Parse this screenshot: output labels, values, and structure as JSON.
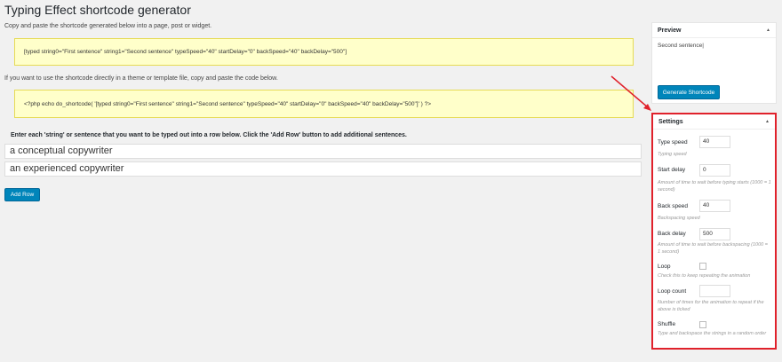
{
  "page": {
    "title": "Typing Effect shortcode generator",
    "intro": "Copy and paste the shortcode generated below into a page, post or widget.",
    "shortcode": "[typed string0=\"First sentence\" string1=\"Second sentence\" typeSpeed=\"40\" startDelay=\"0\" backSpeed=\"40\" backDelay=\"500\"]",
    "intro2": "If you want to use the shortcode directly in a theme or template file, copy and paste the code below.",
    "php_code": "<?php echo do_shortcode( '[typed string0=\"First sentence\" string1=\"Second sentence\" typeSpeed=\"40\" startDelay=\"0\" backSpeed=\"40\" backDelay=\"500\"]' ) ?>",
    "rows_label": "Enter each 'string' or sentence that you want to be typed out into a row below. Click the 'Add Row' button to add additional sentences.",
    "rows": [
      "a conceptual copywriter",
      "an experienced copywriter"
    ],
    "add_row_label": "Add Row"
  },
  "preview": {
    "title": "Preview",
    "text": "Second sentence|",
    "generate_label": "Generate Shortcode"
  },
  "settings": {
    "title": "Settings",
    "type_speed": {
      "label": "Type speed",
      "value": "40",
      "help": "Typing speed"
    },
    "start_delay": {
      "label": "Start delay",
      "value": "0",
      "help": "Amount of time to wait before typing starts (1000 = 1 second)"
    },
    "back_speed": {
      "label": "Back speed",
      "value": "40",
      "help": "Backspacing speed"
    },
    "back_delay": {
      "label": "Back delay",
      "value": "500",
      "help": "Amount of time to wait before backspacing (1000 = 1 second)"
    },
    "loop": {
      "label": "Loop",
      "help": "Check this to keep repeating the animation"
    },
    "loop_count": {
      "label": "Loop count",
      "value": "",
      "help": "Number of times for the animation to repeat if the above is ticked"
    },
    "shuffle": {
      "label": "Shuffle",
      "help": "Type and backspace the strings in a random order"
    }
  },
  "colors": {
    "accent": "#0085ba",
    "highlight": "#e0212b",
    "code_bg": "#ffffca"
  }
}
